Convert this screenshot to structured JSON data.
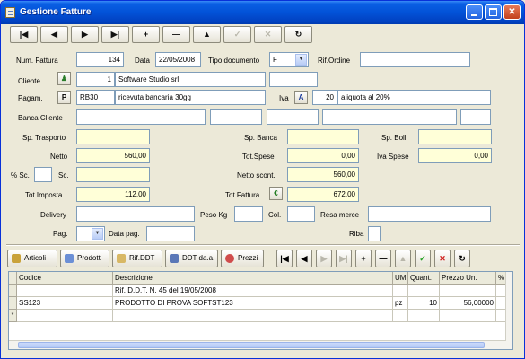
{
  "window": {
    "title": "Gestione Fatture"
  },
  "nav": {
    "first": "|◀",
    "prev": "◀",
    "next": "▶",
    "last": "▶|",
    "add": "+",
    "delete": "—",
    "up": "▲",
    "confirm": "✓",
    "cancel": "✕",
    "refresh": "↻"
  },
  "form": {
    "num_fattura_label": "Num. Fattura",
    "num_fattura": "134",
    "data_label": "Data",
    "data": "22/05/2008",
    "tipo_documento_label": "Tipo documento",
    "tipo_documento": "F",
    "rif_ordine_label": "Rif.Ordine",
    "rif_ordine": "",
    "cliente_label": "Cliente",
    "cliente_code": "1",
    "cliente_name": "Software Studio srl",
    "pagam_label": "Pagam.",
    "pagam_code": "RB30",
    "pagam_desc": "ricevuta bancaria 30gg",
    "iva_label": "Iva",
    "iva_code": "20",
    "iva_desc": "aliquota al 20%",
    "banca_cliente_label": "Banca Cliente",
    "sp_trasporto_label": "Sp. Trasporto",
    "sp_trasporto": "",
    "sp_banca_label": "Sp. Banca",
    "sp_banca": "",
    "sp_bolli_label": "Sp. Bolli",
    "sp_bolli": "",
    "netto_label": "Netto",
    "netto": "560,00",
    "tot_spese_label": "Tot.Spese",
    "tot_spese": "0,00",
    "iva_spese_label": "Iva Spese",
    "iva_spese": "0,00",
    "perc_sc_label": "% Sc.",
    "sc_label": "Sc.",
    "netto_scont_label": "Netto scont.",
    "netto_scont": "560,00",
    "tot_imposta_label": "Tot.Imposta",
    "tot_imposta": "112,00",
    "tot_fattura_label": "Tot.Fattura",
    "tot_fattura": "672,00",
    "delivery_label": "Delivery",
    "peso_kg_label": "Peso Kg",
    "col_label": "Col.",
    "resa_merce_label": "Resa merce",
    "pag_label": "Pag.",
    "data_pag_label": "Data pag.",
    "riba_label": "Riba"
  },
  "toolbar2": {
    "articoli": "Articoli",
    "prodotti": "Prodotti",
    "rif_ddt": "Rif.DDT",
    "ddt_da_a": "DDT da.a.",
    "prezzi": "Prezzi"
  },
  "grid": {
    "columns": [
      "Codice",
      "Descrizione",
      "UM",
      "Quant.",
      "Prezzo Un.",
      "%"
    ],
    "rows": [
      [
        "",
        "Rif. D.D.T. N. 45 del 19/05/2008",
        "",
        "",
        "",
        ""
      ],
      [
        "SS123",
        "PRODOTTO DI PROVA SOFTST123",
        "pz",
        "10",
        "56,00000",
        ""
      ]
    ],
    "new_row_marker": "*"
  }
}
